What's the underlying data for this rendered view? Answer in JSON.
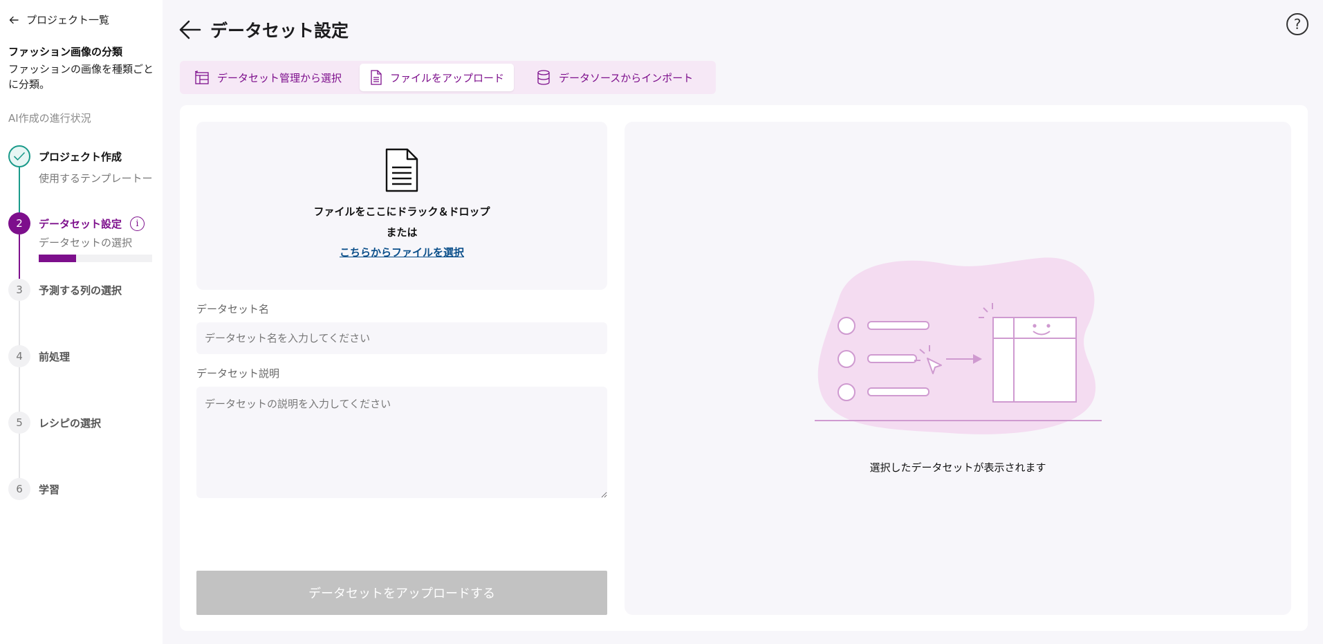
{
  "sidebar": {
    "back_label": "プロジェクト一覧",
    "project_title": "ファッション画像の分類",
    "project_description": "ファッションの画像を種類ごとに分類。",
    "progress_label": "AI作成の進行状況",
    "steps": [
      {
        "number": "",
        "title": "プロジェクト作成",
        "subtitle": "使用するテンプレートー",
        "status": "done"
      },
      {
        "number": "2",
        "title": "データセット設定",
        "subtitle": "データセットの選択",
        "status": "active",
        "progress": 0.33
      },
      {
        "number": "3",
        "title": "予測する列の選択",
        "status": "pending"
      },
      {
        "number": "4",
        "title": "前処理",
        "status": "pending"
      },
      {
        "number": "5",
        "title": "レシピの選択",
        "status": "pending"
      },
      {
        "number": "6",
        "title": "学習",
        "status": "pending"
      }
    ],
    "info_icon_glyph": "i"
  },
  "header": {
    "title": "データセット設定",
    "help_glyph": "?"
  },
  "tabs": [
    {
      "label": "データセット管理から選択",
      "icon": "dataset-table-icon",
      "active": false
    },
    {
      "label": "ファイルをアップロード",
      "icon": "file-icon",
      "active": true
    },
    {
      "label": "データソースからインポート",
      "icon": "database-icon",
      "active": false
    }
  ],
  "upload": {
    "drop_text": "ファイルをここにドラック＆ドロップ",
    "or_text": "または",
    "select_link": "こちらからファイルを選択"
  },
  "form": {
    "name_label": "データセット名",
    "name_placeholder": "データセット名を入力してください",
    "name_value": "",
    "desc_label": "データセット説明",
    "desc_placeholder": "データセットの説明を入力してください",
    "desc_value": "",
    "submit_label": "データセットをアップロードする"
  },
  "preview": {
    "caption": "選択したデータセットが表示されます"
  },
  "colors": {
    "accent": "#7d0f8c",
    "done": "#1a9a8a",
    "tab_bg": "#f6e8f6",
    "disabled_button": "#c2c2c2",
    "link": "#0b4f8a"
  }
}
